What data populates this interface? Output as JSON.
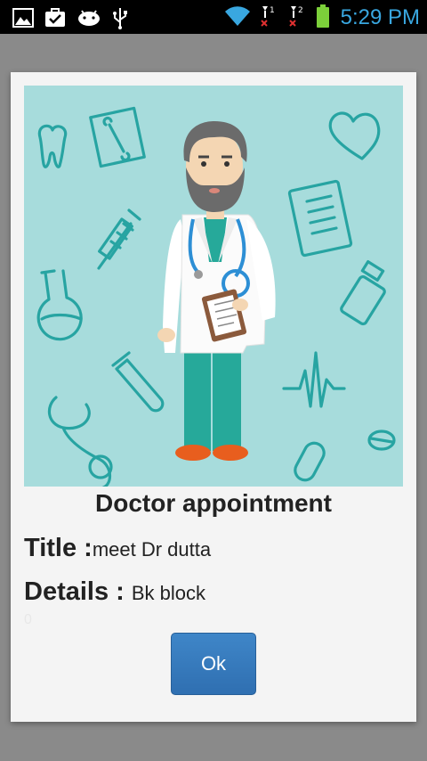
{
  "status_bar": {
    "time": "5:29 PM",
    "icons": [
      "gallery-icon",
      "task-icon",
      "android-icon",
      "usb-icon",
      "wifi-icon",
      "signal-sim1-icon",
      "signal-sim2-icon",
      "battery-icon"
    ],
    "sim1_label": "1",
    "sim2_label": "2",
    "time_color": "#39a7e0"
  },
  "dialog": {
    "title": "Doctor appointment",
    "title_label": "Title :",
    "title_value": "meet Dr dutta",
    "details_label": "Details : ",
    "details_value": "Bk block",
    "faint_text": "0",
    "ok_label": "Ok",
    "illustration_bg": "#a7dcdc",
    "accent": "#27a4a2"
  }
}
